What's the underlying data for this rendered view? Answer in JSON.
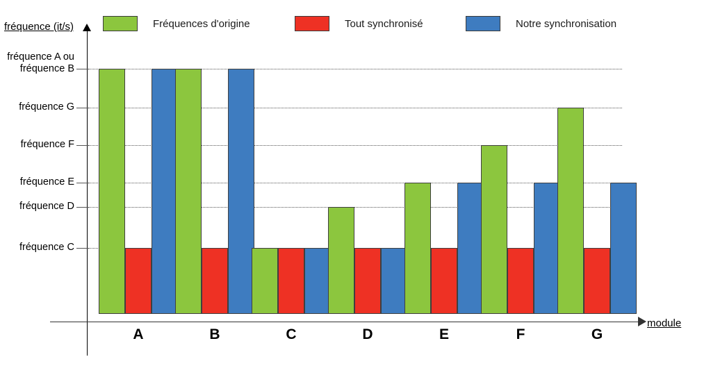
{
  "chart_data": {
    "type": "bar",
    "title": "",
    "xlabel": "module",
    "ylabel": "fréquence (it/s)",
    "grid": true,
    "legend_position": "top",
    "categories": [
      "A",
      "B",
      "C",
      "D",
      "E",
      "F",
      "G"
    ],
    "y_tick_labels": [
      "fréquence A ou\nfréquence B",
      "fréquence G",
      "fréquence F",
      "fréquence E",
      "fréquence D",
      "fréquence C"
    ],
    "y_levels": [
      "fréquence C",
      "fréquence D",
      "fréquence E",
      "fréquence F",
      "fréquence G",
      "fréquence A ou fréquence B"
    ],
    "series": [
      {
        "name": "Fréquences d'origine",
        "color": "#8CC63E",
        "values": [
          "fréquence A ou fréquence B",
          "fréquence A ou fréquence B",
          "fréquence C",
          "fréquence D",
          "fréquence E",
          "fréquence F",
          "fréquence G"
        ]
      },
      {
        "name": "Tout synchronisé",
        "color": "#EE3124",
        "values": [
          "fréquence C",
          "fréquence C",
          "fréquence C",
          "fréquence C",
          "fréquence C",
          "fréquence C",
          "fréquence C"
        ]
      },
      {
        "name": "Notre synchronisation",
        "color": "#3E7CC0",
        "values": [
          "fréquence A ou fréquence B",
          "fréquence A ou fréquence B",
          "fréquence C",
          "fréquence C",
          "fréquence E",
          "fréquence E",
          "fréquence E"
        ]
      }
    ]
  },
  "axes": {
    "y_title": "fréquence (it/s)",
    "x_title": "module"
  },
  "legend": {
    "items": [
      {
        "label": "Fréquences d'origine",
        "color": "#8CC63E"
      },
      {
        "label": "Tout synchronisé",
        "color": "#EE3124"
      },
      {
        "label": "Notre synchronisation",
        "color": "#3E7CC0"
      }
    ]
  },
  "y_axis": {
    "ticks": [
      {
        "label_line1": "fréquence A ou",
        "label_line2": "fréquence B"
      },
      {
        "label_line1": "fréquence G",
        "label_line2": ""
      },
      {
        "label_line1": "fréquence F",
        "label_line2": ""
      },
      {
        "label_line1": "fréquence E",
        "label_line2": ""
      },
      {
        "label_line1": "fréquence D",
        "label_line2": ""
      },
      {
        "label_line1": "fréquence C",
        "label_line2": ""
      }
    ]
  },
  "x_axis": {
    "labels": [
      "A",
      "B",
      "C",
      "D",
      "E",
      "F",
      "G"
    ]
  }
}
